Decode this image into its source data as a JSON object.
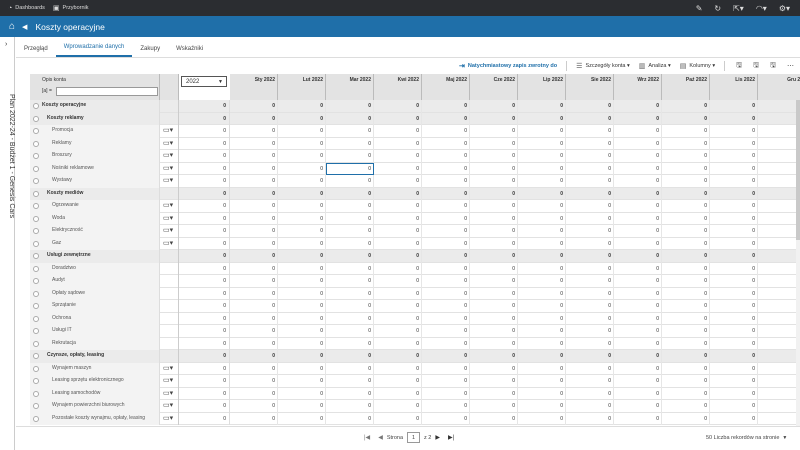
{
  "topbar": {
    "dashboards_label": "Dashboards",
    "przybornik_label": "Przybornik"
  },
  "header": {
    "title": "Koszty operacyjne"
  },
  "side_panel": {
    "vertical_text": "Plan 2022-24 - Budżet 1 - Genesis Cars"
  },
  "tabs": [
    {
      "label": "Przegląd",
      "active": false
    },
    {
      "label": "Wprowadzanie danych",
      "active": true
    },
    {
      "label": "Zakupy",
      "active": false
    },
    {
      "label": "Wskaźniki",
      "active": false
    }
  ],
  "toolbar": {
    "instant_writeback": "Natychmiastowy zapis zwrotny do",
    "account_details": "Szczegóły konta",
    "analysis": "Analiza",
    "columns": "Kolumny"
  },
  "grid": {
    "header_label": "Opis konta",
    "filter_prefix": "[a] =",
    "year_selected": "2022",
    "months": [
      "Sty 2022",
      "Lut 2022",
      "Mar 2022",
      "Kwi 2022",
      "Maj 2022",
      "Cze 2022",
      "Lip 2022",
      "Sie 2022",
      "Wrz 2022",
      "Paź 2022",
      "Lis 2022",
      "Gru 20"
    ],
    "cell_value": "0",
    "rows": [
      {
        "name": "Koszty operacyjne",
        "level": 0,
        "group": true,
        "calendar": false
      },
      {
        "name": "Koszty reklamy",
        "level": 1,
        "group": true,
        "calendar": false
      },
      {
        "name": "Promocja",
        "level": 2,
        "group": false,
        "calendar": true
      },
      {
        "name": "Reklamy",
        "level": 2,
        "group": false,
        "calendar": true
      },
      {
        "name": "Broszury",
        "level": 2,
        "group": false,
        "calendar": true
      },
      {
        "name": "Nośniki reklamowe",
        "level": 2,
        "group": false,
        "calendar": true
      },
      {
        "name": "Wystawy",
        "level": 2,
        "group": false,
        "calendar": true
      },
      {
        "name": "Koszty mediów",
        "level": 1,
        "group": true,
        "calendar": false
      },
      {
        "name": "Ogrzewanie",
        "level": 2,
        "group": false,
        "calendar": true
      },
      {
        "name": "Woda",
        "level": 2,
        "group": false,
        "calendar": true
      },
      {
        "name": "Elektryczność",
        "level": 2,
        "group": false,
        "calendar": true
      },
      {
        "name": "Gaz",
        "level": 2,
        "group": false,
        "calendar": true
      },
      {
        "name": "Usługi zewnętrzne",
        "level": 1,
        "group": true,
        "calendar": false
      },
      {
        "name": "Doradztwo",
        "level": 2,
        "group": false,
        "calendar": false
      },
      {
        "name": "Audyt",
        "level": 2,
        "group": false,
        "calendar": false
      },
      {
        "name": "Opłaty sądowe",
        "level": 2,
        "group": false,
        "calendar": false
      },
      {
        "name": "Sprzątanie",
        "level": 2,
        "group": false,
        "calendar": false
      },
      {
        "name": "Ochrona",
        "level": 2,
        "group": false,
        "calendar": false
      },
      {
        "name": "Usługi IT",
        "level": 2,
        "group": false,
        "calendar": false
      },
      {
        "name": "Rekrutacja",
        "level": 2,
        "group": false,
        "calendar": false
      },
      {
        "name": "Czynsze, opłaty, leasing",
        "level": 1,
        "group": true,
        "calendar": false
      },
      {
        "name": "Wynajem maszyn",
        "level": 2,
        "group": false,
        "calendar": true
      },
      {
        "name": "Leasing sprzętu elektronicznego",
        "level": 2,
        "group": false,
        "calendar": true
      },
      {
        "name": "Leasing samochodów",
        "level": 2,
        "group": false,
        "calendar": true
      },
      {
        "name": "Wynajem powierzchni biurowych",
        "level": 2,
        "group": false,
        "calendar": true
      },
      {
        "name": "Pozostałe koszty wynajmu, opłaty, leasing",
        "level": 2,
        "group": false,
        "calendar": true
      }
    ]
  },
  "pager": {
    "page_label": "Strona",
    "current_page": "1",
    "total_pages": "z 2"
  },
  "records_per_page": "50 Liczba rekordów na stronie"
}
